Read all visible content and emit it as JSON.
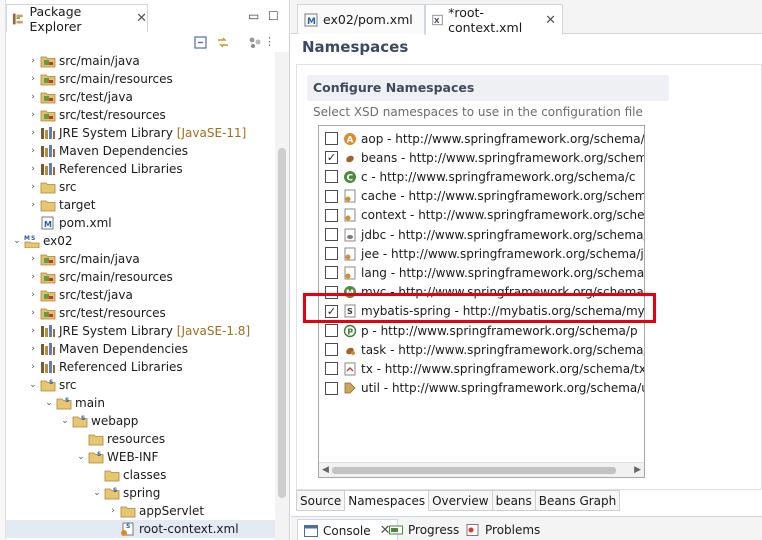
{
  "package_explorer": {
    "tab_label": "Package Explorer",
    "close": "✕",
    "minimize": "▭",
    "maximize": "☐",
    "tree": [
      {
        "indent": 1,
        "arrow": "›",
        "icon": "source-folder-icon",
        "label": "src/main/java"
      },
      {
        "indent": 1,
        "arrow": "›",
        "icon": "source-folder-icon",
        "label": "src/main/resources"
      },
      {
        "indent": 1,
        "arrow": "›",
        "icon": "source-folder-icon",
        "label": "src/test/java"
      },
      {
        "indent": 1,
        "arrow": "›",
        "icon": "source-folder-icon",
        "label": "src/test/resources"
      },
      {
        "indent": 1,
        "arrow": "›",
        "icon": "library-icon",
        "label": "JRE System Library",
        "extra": "[JavaSE-11]"
      },
      {
        "indent": 1,
        "arrow": "›",
        "icon": "library-icon",
        "label": "Maven Dependencies"
      },
      {
        "indent": 1,
        "arrow": "›",
        "icon": "library-icon",
        "label": "Referenced Libraries"
      },
      {
        "indent": 1,
        "arrow": "›",
        "icon": "folder-icon",
        "label": "src"
      },
      {
        "indent": 1,
        "arrow": "›",
        "icon": "folder-icon",
        "label": "target"
      },
      {
        "indent": 1,
        "arrow": "",
        "icon": "maven-pom-icon",
        "label": "pom.xml"
      },
      {
        "indent": 0,
        "arrow": "⌄",
        "icon": "maven-project-icon",
        "label": "ex02"
      },
      {
        "indent": 1,
        "arrow": "›",
        "icon": "source-folder-icon",
        "label": "src/main/java"
      },
      {
        "indent": 1,
        "arrow": "›",
        "icon": "source-folder-icon",
        "label": "src/main/resources"
      },
      {
        "indent": 1,
        "arrow": "›",
        "icon": "source-folder-icon",
        "label": "src/test/java"
      },
      {
        "indent": 1,
        "arrow": "›",
        "icon": "source-folder-icon",
        "label": "src/test/resources"
      },
      {
        "indent": 1,
        "arrow": "›",
        "icon": "library-icon",
        "label": "JRE System Library",
        "extra": "[JavaSE-1.8]"
      },
      {
        "indent": 1,
        "arrow": "›",
        "icon": "library-icon",
        "label": "Maven Dependencies"
      },
      {
        "indent": 1,
        "arrow": "›",
        "icon": "library-icon",
        "label": "Referenced Libraries"
      },
      {
        "indent": 1,
        "arrow": "⌄",
        "icon": "spring-folder-icon",
        "label": "src"
      },
      {
        "indent": 2,
        "arrow": "⌄",
        "icon": "spring-folder-icon",
        "label": "main"
      },
      {
        "indent": 3,
        "arrow": "⌄",
        "icon": "spring-folder-icon",
        "label": "webapp"
      },
      {
        "indent": 4,
        "arrow": "",
        "icon": "folder-icon",
        "label": "resources"
      },
      {
        "indent": 4,
        "arrow": "⌄",
        "icon": "spring-folder-icon",
        "label": "WEB-INF"
      },
      {
        "indent": 5,
        "arrow": "",
        "icon": "folder-icon",
        "label": "classes"
      },
      {
        "indent": 5,
        "arrow": "⌄",
        "icon": "spring-folder-icon",
        "label": "spring"
      },
      {
        "indent": 6,
        "arrow": "›",
        "icon": "folder-icon",
        "label": "appServlet"
      },
      {
        "indent": 6,
        "arrow": "",
        "icon": "spring-xml-icon",
        "label": "root-context.xml",
        "selected": true
      }
    ]
  },
  "editor": {
    "tabs": [
      {
        "label": "ex02/pom.xml",
        "icon": "maven-pom-icon",
        "active": false
      },
      {
        "label": "*root-context.xml",
        "icon": "xml-file-icon",
        "active": true,
        "close": "✕"
      }
    ],
    "title": "Namespaces",
    "section_title": "Configure Namespaces",
    "section_desc": "Select XSD namespaces to use in the configuration file",
    "namespaces": [
      {
        "checked": false,
        "icon": "aop-icon",
        "text": "aop - http://www.springframework.org/schema/aop"
      },
      {
        "checked": true,
        "icon": "beans-icon",
        "text": "beans - http://www.springframework.org/schema/be"
      },
      {
        "checked": false,
        "icon": "c-icon",
        "text": "c - http://www.springframework.org/schema/c"
      },
      {
        "checked": false,
        "icon": "cache-icon",
        "text": "cache - http://www.springframework.org/schema/ca"
      },
      {
        "checked": false,
        "icon": "context-icon",
        "text": "context - http://www.springframework.org/schema/c"
      },
      {
        "checked": false,
        "icon": "jdbc-icon",
        "text": "jdbc - http://www.springframework.org/schema/jdbc"
      },
      {
        "checked": false,
        "icon": "jee-icon",
        "text": "jee - http://www.springframework.org/schema/jee"
      },
      {
        "checked": false,
        "icon": "lang-icon",
        "text": "lang - http://www.springframework.org/schema/lang"
      },
      {
        "checked": false,
        "icon": "mvc-icon",
        "text": "mvc - http://www.springframework.org/schema/mvc"
      },
      {
        "checked": true,
        "icon": "mybatis-icon",
        "text": "mybatis-spring - http://mybatis.org/schema/mybatis"
      },
      {
        "checked": false,
        "icon": "p-icon",
        "text": "p - http://www.springframework.org/schema/p"
      },
      {
        "checked": false,
        "icon": "task-icon",
        "text": "task - http://www.springframework.org/schema/task"
      },
      {
        "checked": false,
        "icon": "tx-icon",
        "text": "tx - http://www.springframework.org/schema/tx"
      },
      {
        "checked": false,
        "icon": "util-icon",
        "text": "util - http://www.springframework.org/schema/util"
      }
    ],
    "check_mark": "✓",
    "bottom_tabs": [
      "Source",
      "Namespaces",
      "Overview",
      "beans",
      "Beans Graph"
    ],
    "active_bottom_tab": 1,
    "scroll_left": "◀",
    "scroll_right": "▶"
  },
  "console_bar": {
    "tabs": [
      {
        "label": "Console",
        "icon": "console-icon",
        "active": true,
        "close": "✕"
      },
      {
        "label": "Progress",
        "icon": "progress-icon",
        "active": false
      },
      {
        "label": "Problems",
        "icon": "problems-icon",
        "active": false
      }
    ]
  },
  "colors": {
    "highlight": "#e60012",
    "accent_title": "#3b4a63",
    "library_extra": "#a26d1b"
  }
}
